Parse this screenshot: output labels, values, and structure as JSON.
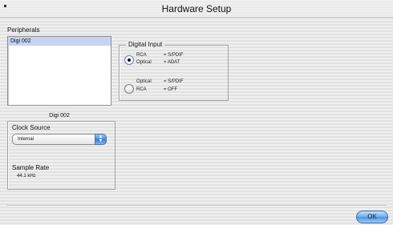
{
  "window": {
    "title": "Hardware Setup"
  },
  "peripherals": {
    "label": "Peripherals",
    "items": [
      "Digi 002"
    ],
    "selected_caption": "Digi 002"
  },
  "digital_input": {
    "title": "Digital Input",
    "options": [
      {
        "line1_name": "RCA",
        "line1_value": "= S/PDIF",
        "line2_name": "Optical",
        "line2_value": "= ADAT",
        "selected": true
      },
      {
        "line1_name": "Optical",
        "line1_value": "= S/PDIF",
        "line2_name": "RCA",
        "line2_value": "= OFF",
        "selected": false
      }
    ]
  },
  "clock_source": {
    "label": "Clock Source",
    "selected": "Internal"
  },
  "sample_rate": {
    "label": "Sample Rate",
    "value": "44.1 kHz"
  },
  "buttons": {
    "ok": "OK"
  },
  "icons": {
    "popup_arrows": "up-down-arrows-icon",
    "radio_selected": "radio-selected-icon"
  }
}
